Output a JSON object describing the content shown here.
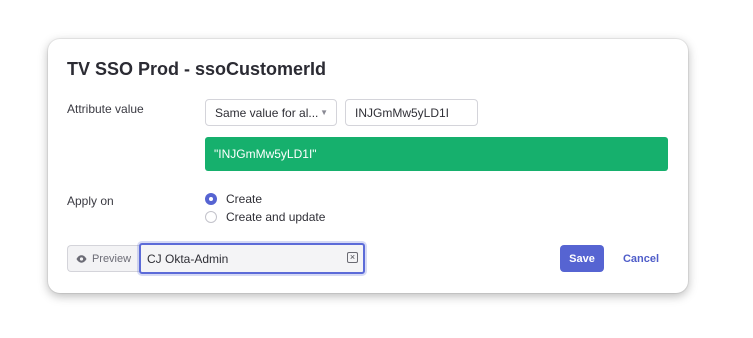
{
  "modal": {
    "title": "TV SSO Prod - ssoCustomerId"
  },
  "attribute": {
    "label": "Attribute value",
    "select_value": "Same value for al...",
    "input_value": "INJGmMw5yLD1I",
    "preview_value": "\"INJGmMw5yLD1I\""
  },
  "apply": {
    "label": "Apply on",
    "options": [
      {
        "label": "Create",
        "selected": true
      },
      {
        "label": "Create and update",
        "selected": false
      }
    ]
  },
  "footer": {
    "preview_label": "Preview",
    "user_value": "CJ Okta-Admin",
    "save_label": "Save",
    "cancel_label": "Cancel"
  },
  "colors": {
    "accent": "#5664d2",
    "success": "#16b06d"
  }
}
